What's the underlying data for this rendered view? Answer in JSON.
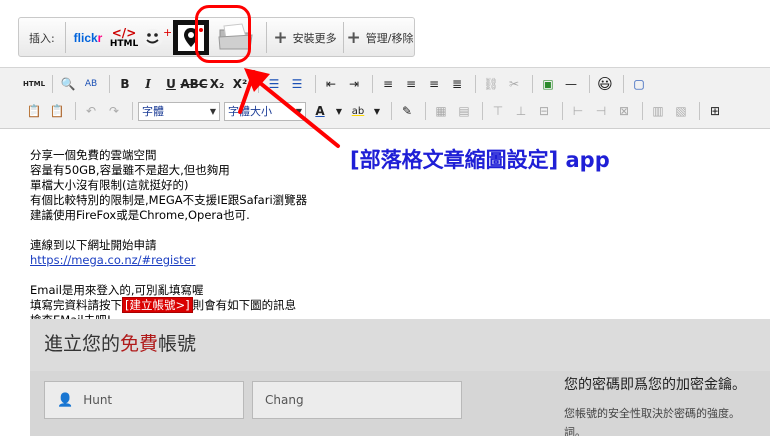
{
  "insert_bar": {
    "label": "插入:",
    "flickr_part1": "flick",
    "flickr_part2": "r",
    "html_code": "</>",
    "html_label": "HTML",
    "install_more": "安裝更多",
    "manage": "管理/移除"
  },
  "toolbar": {
    "html_icon": "HTML",
    "font_select": "字體",
    "size_select": "字體大小"
  },
  "content": {
    "lines_1": [
      "分享一個免費的雲端空間",
      "容量有50GB,容量雖不是超大,但也夠用",
      "單檔大小沒有限制(這就挺好的)",
      "有個比較特別的限制是,MEGA不支援IE跟Safari瀏覽器",
      "建議使用FireFox或是Chrome,Opera也可."
    ],
    "intro_link_text": "連線到以下網址開始申請",
    "link": "https://mega.co.nz/#register",
    "email_line": "Email是用來登入的,可別亂填寫喔",
    "fill_before": "填寫完資料請按下",
    "register_btn": "[建立帳號>]",
    "fill_after": "則會有如下圖的訊息",
    "check_line": "檢查EMail去吧!"
  },
  "embedded": {
    "title_before": "進立您的",
    "title_free": "免費",
    "title_after": "帳號",
    "first_name": "Hunt",
    "last_name": "Chang",
    "pw_line1": "您的密碼即爲您的加密金鑰。",
    "pw_line2": "您帳號的安全性取決於密碼的強度。",
    "pw_line3": "詞。"
  },
  "annotation": {
    "label": "[部落格文章縮圖設定] app",
    "color": "#ff0000"
  }
}
